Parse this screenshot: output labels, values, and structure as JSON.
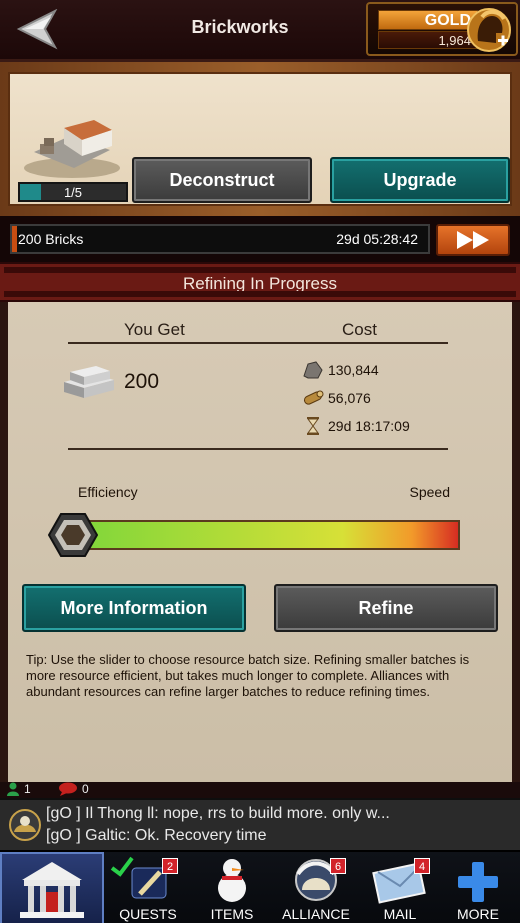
{
  "header": {
    "title": "Brickworks",
    "gold_label": "GOLD",
    "gold_amount": "1,964"
  },
  "building": {
    "level_text": "1/5",
    "level_progress": 0.2,
    "deconstruct_label": "Deconstruct",
    "upgrade_label": "Upgrade"
  },
  "progress": {
    "label": "200 Bricks",
    "time": "29d 05:28:42",
    "fraction": 0.01
  },
  "refining": {
    "title": "Refining In Progress",
    "you_get_header": "You Get",
    "cost_header": "Cost",
    "amount": "200",
    "costs": {
      "stone": "130,844",
      "wood": "56,076",
      "time": "29d 18:17:09"
    },
    "efficiency_label": "Efficiency",
    "speed_label": "Speed",
    "slider_position": 0.0,
    "more_info_label": "More Information",
    "refine_label": "Refine",
    "tip": "Tip: Use the slider to choose resource batch size. Refining smaller batches is more resource efficient, but takes much longer to complete. Alliances with abundant resources can refine larger batches to reduce refining times."
  },
  "status": {
    "online": "1",
    "alerts": "0"
  },
  "chat": {
    "line1": "[gO ] Il Thong ll: nope,  rrs to build more.  only w...",
    "line2": "[gO ] Galtic: Ok. Recovery time"
  },
  "nav": {
    "quests": {
      "label": "QUESTS",
      "badge": "2"
    },
    "items": {
      "label": "ITEMS"
    },
    "alliance": {
      "label": "ALLIANCE",
      "badge": "6"
    },
    "mail": {
      "label": "MAIL",
      "badge": "4"
    },
    "more": {
      "label": "MORE"
    }
  },
  "colors": {
    "accent_teal": "#137070",
    "brick_red": "#6a1a14",
    "gold": "#f3a43a"
  }
}
